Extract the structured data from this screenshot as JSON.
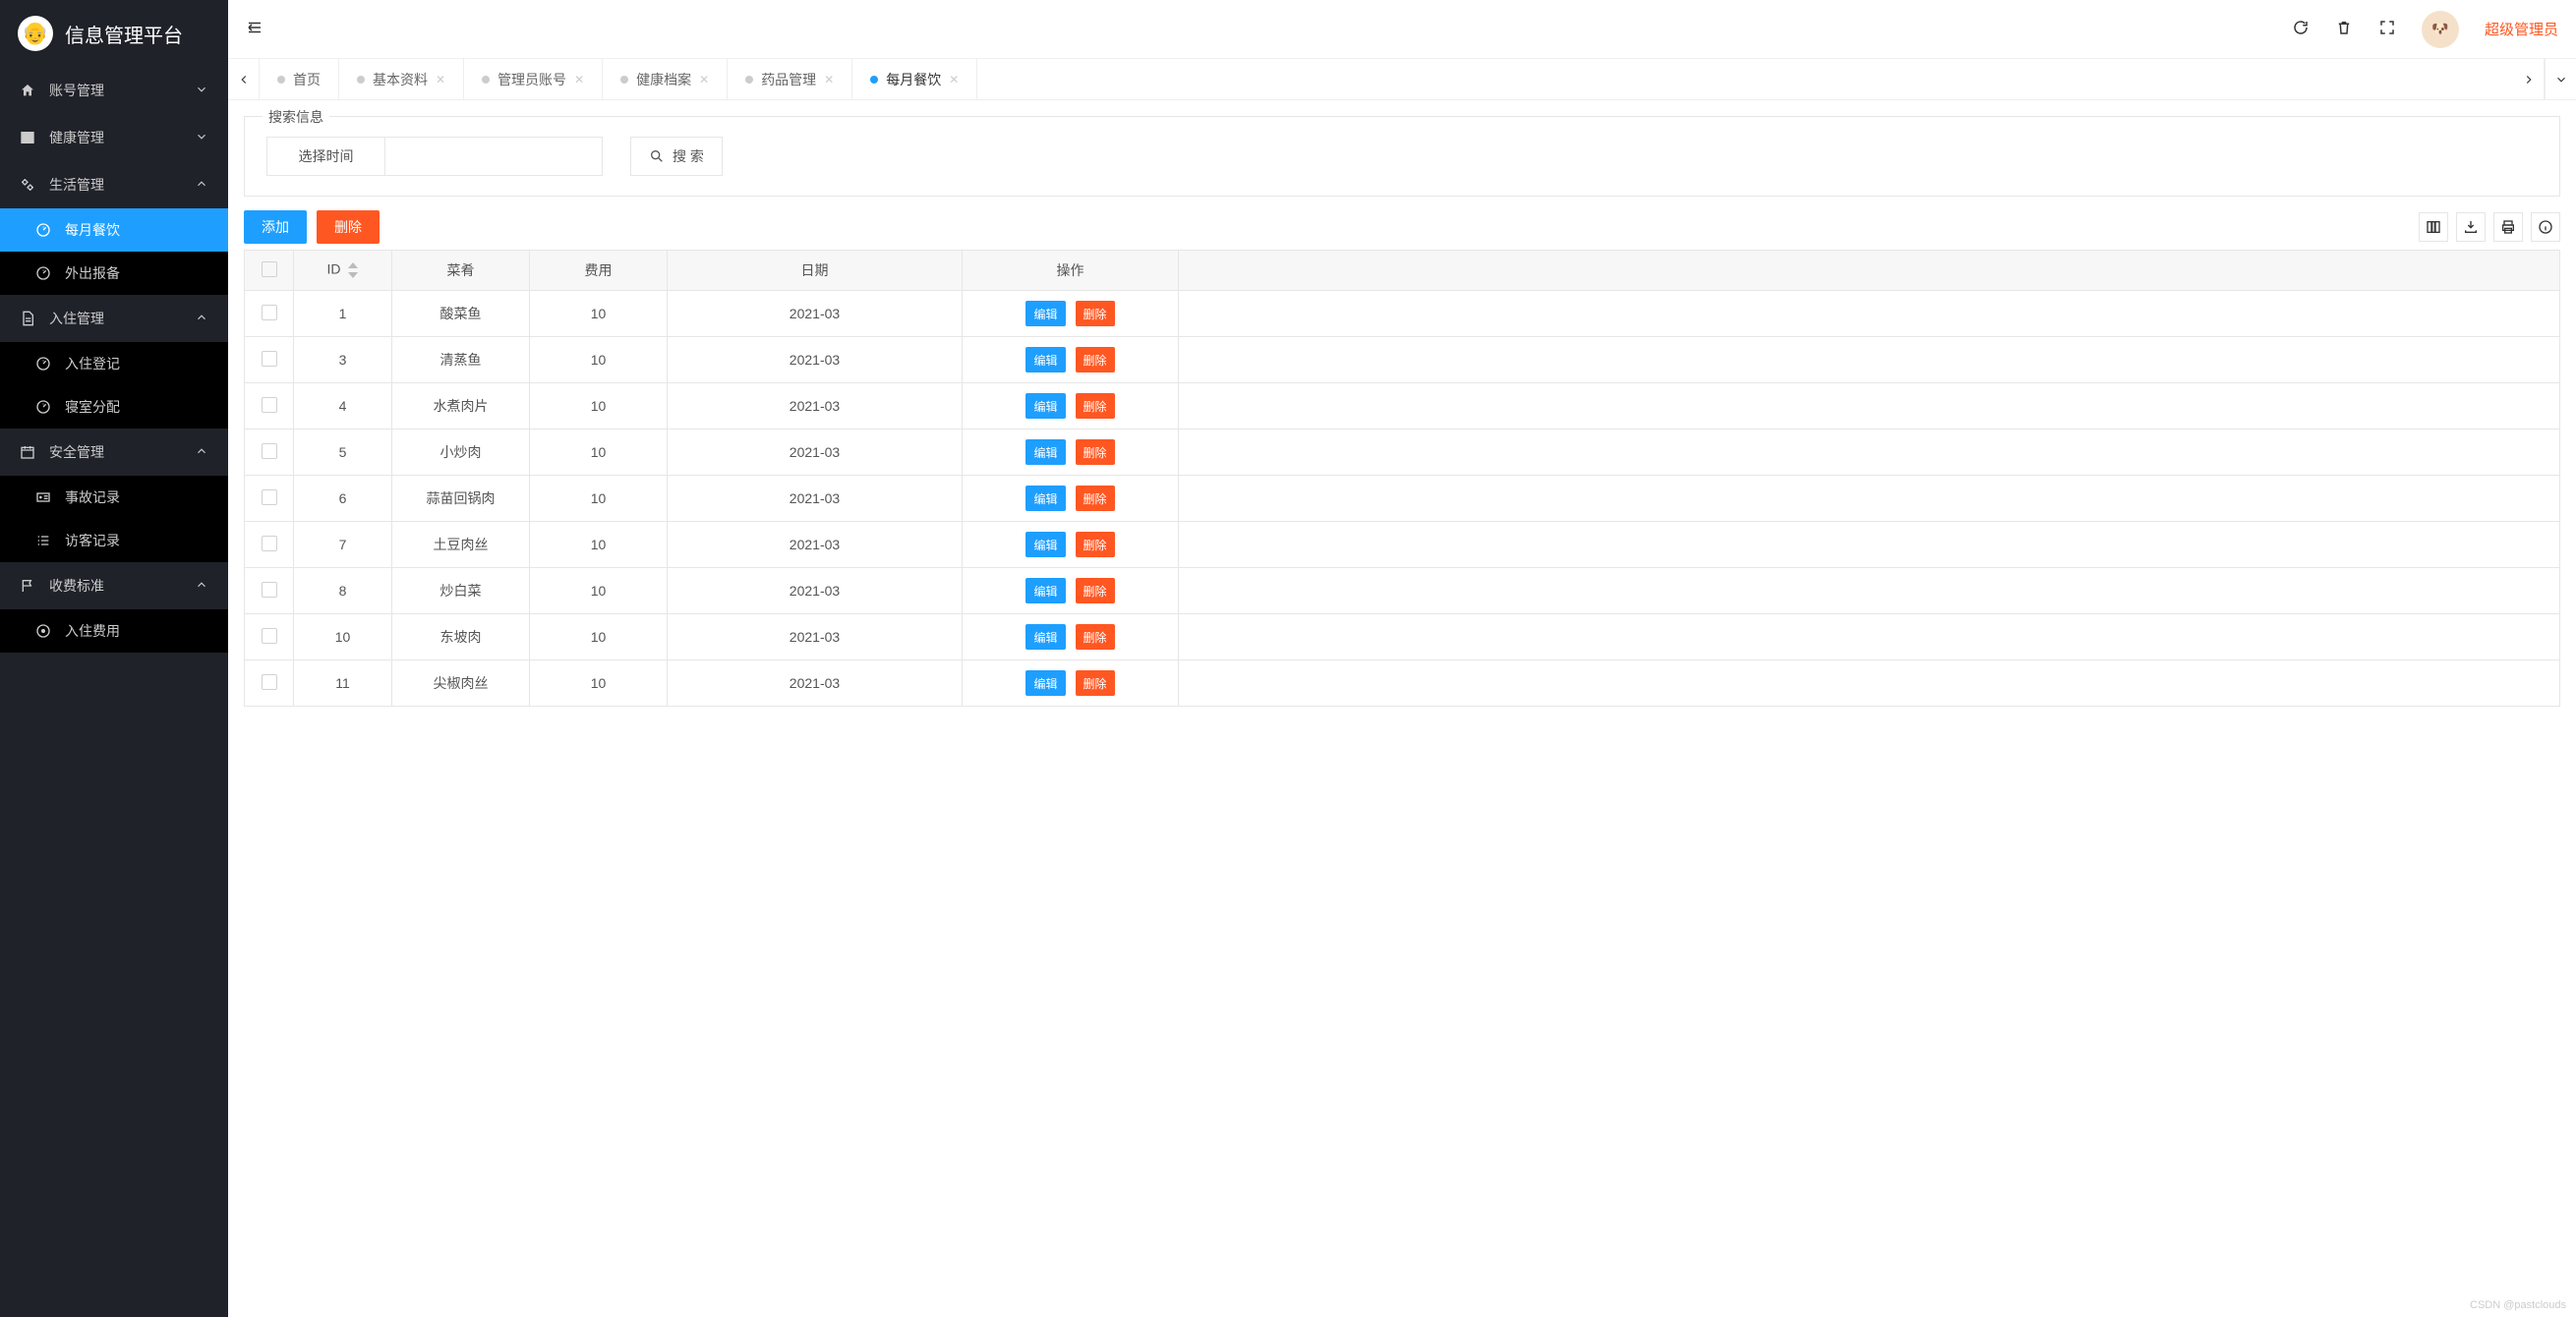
{
  "app": {
    "title": "信息管理平台"
  },
  "sidebar": {
    "groups": [
      {
        "label": "账号管理",
        "icon": "home",
        "expanded": false
      },
      {
        "label": "健康管理",
        "icon": "window",
        "expanded": false
      },
      {
        "label": "生活管理",
        "icon": "gears",
        "expanded": true,
        "items": [
          {
            "label": "每月餐饮",
            "icon": "dashboard",
            "active": true
          },
          {
            "label": "外出报备",
            "icon": "dashboard",
            "active": false
          }
        ]
      },
      {
        "label": "入住管理",
        "icon": "doc",
        "expanded": true,
        "items": [
          {
            "label": "入住登记",
            "icon": "dashboard",
            "active": false
          },
          {
            "label": "寝室分配",
            "icon": "dashboard",
            "active": false
          }
        ]
      },
      {
        "label": "安全管理",
        "icon": "calendar",
        "expanded": true,
        "items": [
          {
            "label": "事故记录",
            "icon": "card",
            "active": false
          },
          {
            "label": "访客记录",
            "icon": "list",
            "active": false
          }
        ]
      },
      {
        "label": "收费标准",
        "icon": "flag",
        "expanded": true,
        "items": [
          {
            "label": "入住费用",
            "icon": "disc",
            "active": false
          }
        ]
      }
    ]
  },
  "topbar": {
    "username": "超级管理员"
  },
  "tabs": [
    {
      "label": "首页",
      "active": false,
      "closable": false
    },
    {
      "label": "基本资料",
      "active": false,
      "closable": true
    },
    {
      "label": "管理员账号",
      "active": false,
      "closable": true
    },
    {
      "label": "健康档案",
      "active": false,
      "closable": true
    },
    {
      "label": "药品管理",
      "active": false,
      "closable": true
    },
    {
      "label": "每月餐饮",
      "active": true,
      "closable": true
    }
  ],
  "search": {
    "fieldset_title": "搜索信息",
    "date_label": "选择时间",
    "search_button": "搜 索"
  },
  "actions": {
    "add": "添加",
    "delete": "删除"
  },
  "table": {
    "headers": [
      "ID",
      "菜肴",
      "费用",
      "日期",
      "操作"
    ],
    "row_actions": {
      "edit": "编辑",
      "delete": "删除"
    },
    "rows": [
      {
        "id": "1",
        "dish": "酸菜鱼",
        "cost": "10",
        "date": "2021-03"
      },
      {
        "id": "3",
        "dish": "清蒸鱼",
        "cost": "10",
        "date": "2021-03"
      },
      {
        "id": "4",
        "dish": "水煮肉片",
        "cost": "10",
        "date": "2021-03"
      },
      {
        "id": "5",
        "dish": "小炒肉",
        "cost": "10",
        "date": "2021-03"
      },
      {
        "id": "6",
        "dish": "蒜苗回锅肉",
        "cost": "10",
        "date": "2021-03"
      },
      {
        "id": "7",
        "dish": "土豆肉丝",
        "cost": "10",
        "date": "2021-03"
      },
      {
        "id": "8",
        "dish": "炒白菜",
        "cost": "10",
        "date": "2021-03"
      },
      {
        "id": "10",
        "dish": "东坡肉",
        "cost": "10",
        "date": "2021-03"
      },
      {
        "id": "11",
        "dish": "尖椒肉丝",
        "cost": "10",
        "date": "2021-03"
      }
    ]
  },
  "watermark": "CSDN @pastclouds"
}
